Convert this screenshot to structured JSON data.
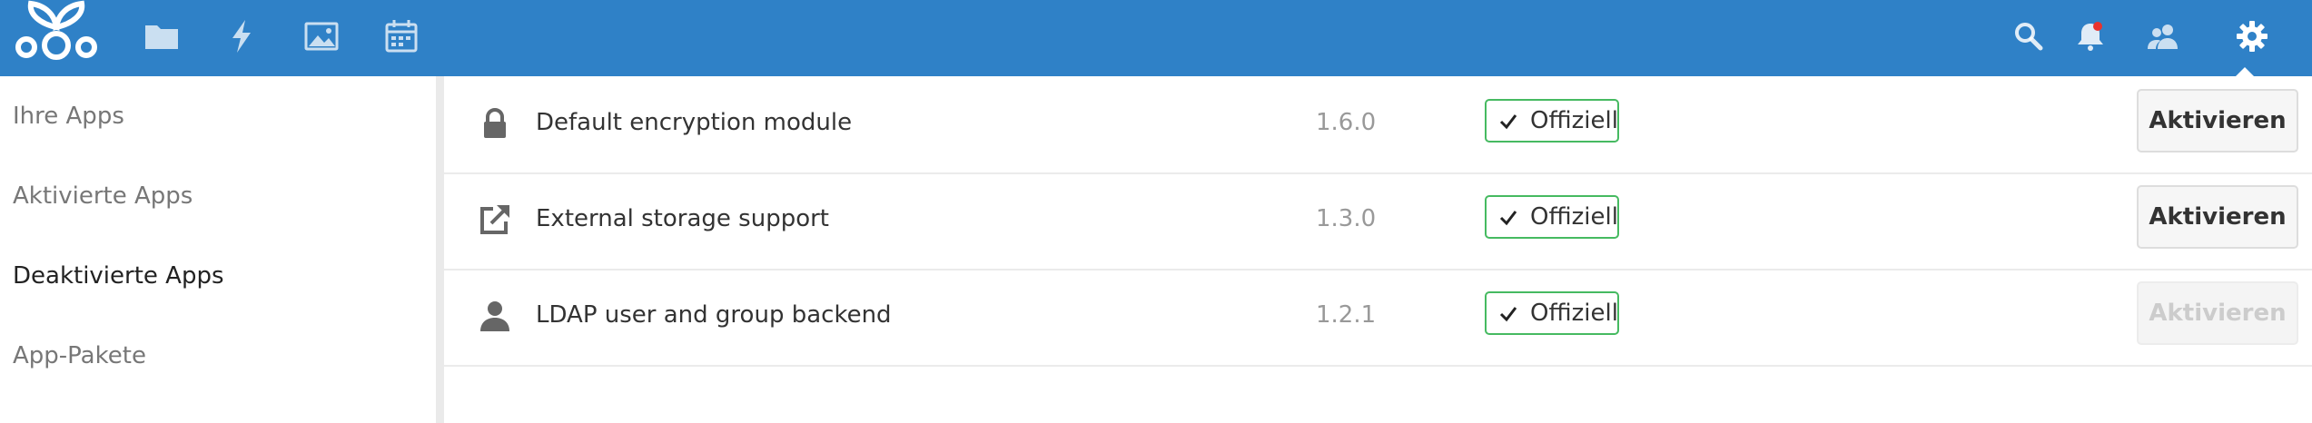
{
  "colors": {
    "header": "#2f81c7",
    "badge_border": "#46ba61",
    "notification_dot": "#e9322d"
  },
  "header": {
    "nav": [
      "files-icon",
      "activity-icon",
      "gallery-icon",
      "calendar-icon"
    ],
    "right": [
      "search-icon",
      "notifications-icon",
      "contacts-icon",
      "settings-icon"
    ]
  },
  "sidebar": {
    "items": [
      {
        "label": "Ihre Apps"
      },
      {
        "label": "Aktivierte Apps"
      },
      {
        "label": "Deaktivierte Apps",
        "active": true
      },
      {
        "label": "App-Pakete"
      }
    ]
  },
  "apps": [
    {
      "icon": "lock-icon",
      "name": "Default encryption module",
      "version": "1.6.0",
      "badge": "Offiziell",
      "action": "Aktivieren",
      "disabled": false
    },
    {
      "icon": "external-link-icon",
      "name": "External storage support",
      "version": "1.3.0",
      "badge": "Offiziell",
      "action": "Aktivieren",
      "disabled": false
    },
    {
      "icon": "user-icon",
      "name": "LDAP user and group backend",
      "version": "1.2.1",
      "badge": "Offiziell",
      "action": "Aktivieren",
      "disabled": true
    }
  ]
}
